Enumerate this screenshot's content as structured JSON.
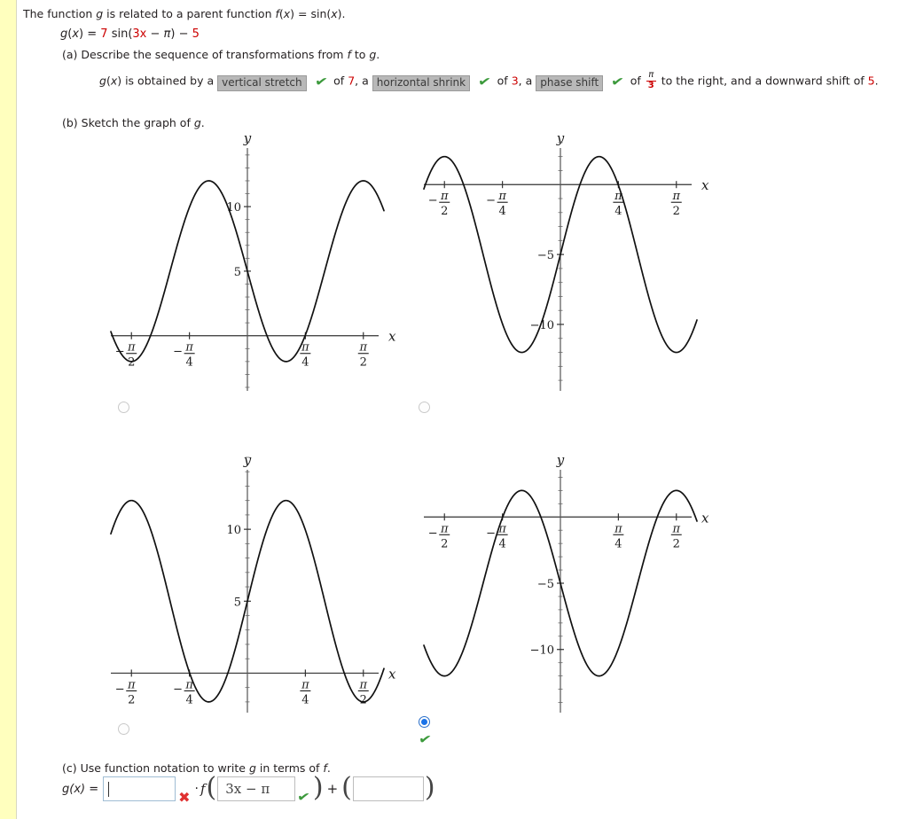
{
  "problem": {
    "statement_pre": "The function ",
    "statement_g": "g",
    "statement_mid": " is related to a parent function ",
    "statement_f": "f(x)",
    "statement_eq": " = sin(x).",
    "full_statement": "The function g is related to a parent function f(x) = sin(x).",
    "formula": "g(x) = 7 sin(3x − π) − 5",
    "formula_parts": {
      "lhs": "g(x) =",
      "amplitude": "7",
      "sin": "sin(",
      "inner_b": "3x",
      "inner_minus": " − ",
      "inner_c": "π",
      "close": ")",
      "shift_sign": " − ",
      "shift": "5"
    },
    "part_a_label": "(a) Describe the sequence of transformations from f to g.",
    "part_b_label": "(b) Sketch the graph of g.",
    "part_c_label": "(c) Use function notation to write g in terms of f."
  },
  "transformation_sentence": {
    "lead": "g(x) is obtained by a",
    "dropdown_1": "vertical stretch",
    "of_1": "of",
    "value_1": "7",
    "comma_a": ", a",
    "dropdown_2": "horizontal shrink",
    "of_2": "of",
    "value_2": "3",
    "comma_b": ", a",
    "dropdown_3": "phase shift",
    "of_3": "of",
    "frac_num": "π",
    "frac_den": "3",
    "tail": "to the right, and a downward shift of",
    "value_3": "5",
    "period": ".",
    "check_glyph": "✔"
  },
  "colors": {
    "accent_red": "#cc0000",
    "check_green": "#3c9a3c",
    "cross_red": "#e03030",
    "radio_blue": "#1a73e8",
    "dropdown_grey": "#b8b8b8",
    "gutter_yellow": "#ffffbe"
  },
  "graph_options": [
    {
      "id": "option-a",
      "selected": false,
      "correct_mark": false,
      "axis": {
        "x_label": "x",
        "y_label": "y"
      },
      "x_ticks": [
        "-π/2",
        "-π/4",
        "π/4",
        "π/2"
      ],
      "y_ticks": [
        "5",
        "10"
      ],
      "chart_data": {
        "type": "line",
        "title": "",
        "xlabel": "x",
        "ylabel": "y",
        "expression": "y = 7 sin(3x − π) + 5",
        "amplitude": 7,
        "frequency": 3,
        "phase": "−π",
        "vertical_shift": 5,
        "xlim": [
          -1.85,
          1.85
        ],
        "ylim": [
          -4.0,
          15.5
        ],
        "x_tick_values": [
          -1.5708,
          -0.7854,
          0.7854,
          1.5708
        ],
        "y_tick_values": [
          5,
          10
        ],
        "grid": false
      }
    },
    {
      "id": "option-b",
      "selected": false,
      "correct_mark": false,
      "axis": {
        "x_label": "x",
        "y_label": "y"
      },
      "x_ticks": [
        "-π/2",
        "-π/4",
        "π/4",
        "π/2"
      ],
      "y_ticks": [
        "-5",
        "-10"
      ],
      "chart_data": {
        "type": "line",
        "title": "",
        "xlabel": "x",
        "ylabel": "y",
        "expression": "y = 7 sin(3x) − 5",
        "amplitude": 7,
        "frequency": 3,
        "phase": "0",
        "vertical_shift": -5,
        "xlim": [
          -1.85,
          1.85
        ],
        "ylim": [
          -14.5,
          3.5
        ],
        "x_tick_values": [
          -1.5708,
          -0.7854,
          0.7854,
          1.5708
        ],
        "y_tick_values": [
          -5,
          -10
        ],
        "grid": false
      }
    },
    {
      "id": "option-c",
      "selected": false,
      "correct_mark": false,
      "axis": {
        "x_label": "x",
        "y_label": "y"
      },
      "x_ticks": [
        "-π/2",
        "-π/4",
        "π/4",
        "π/2"
      ],
      "y_ticks": [
        "5",
        "10"
      ],
      "chart_data": {
        "type": "line",
        "title": "",
        "xlabel": "x",
        "ylabel": "y",
        "expression": "y = 7 sin(3x) + 5",
        "amplitude": 7,
        "frequency": 3,
        "phase": "0",
        "vertical_shift": 5,
        "xlim": [
          -1.85,
          1.85
        ],
        "ylim": [
          -2.5,
          15.0
        ],
        "x_tick_values": [
          -1.5708,
          -0.7854,
          0.7854,
          1.5708
        ],
        "y_tick_values": [
          5,
          10
        ],
        "grid": false
      }
    },
    {
      "id": "option-d",
      "selected": true,
      "correct_mark": true,
      "axis": {
        "x_label": "x",
        "y_label": "y"
      },
      "x_ticks": [
        "-π/2",
        "-π/4",
        "π/4",
        "π/2"
      ],
      "y_ticks": [
        "-5",
        "-10"
      ],
      "chart_data": {
        "type": "line",
        "title": "",
        "xlabel": "x",
        "ylabel": "y",
        "expression": "y = 7 sin(3x − π) − 5",
        "amplitude": 7,
        "frequency": 3,
        "phase": "−π",
        "vertical_shift": -5,
        "xlim": [
          -1.85,
          1.85
        ],
        "ylim": [
          -14.5,
          4.5
        ],
        "x_tick_values": [
          -1.5708,
          -0.7854,
          0.7854,
          1.5708
        ],
        "y_tick_values": [
          -5,
          -10
        ],
        "grid": false
      }
    }
  ],
  "answer_row": {
    "label": "g(x) =",
    "field_1_value": "",
    "field_1_state": "incorrect",
    "dot": "·",
    "f_symbol": "f",
    "open_paren": "(",
    "field_2_value": "3x − π",
    "field_2_state": "correct",
    "close_paren": ")",
    "plus": "+",
    "open_paren_2": "(",
    "field_3_value": "",
    "field_3_state": "blank",
    "close_paren_2": ")",
    "cross_glyph": "✖",
    "check_glyph": "✔"
  }
}
